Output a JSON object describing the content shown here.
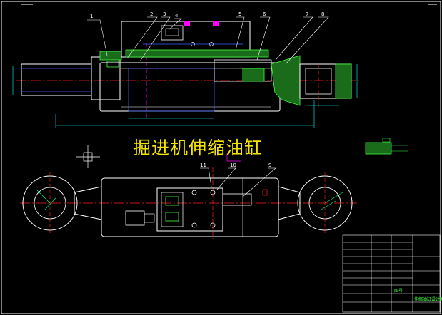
{
  "drawing": {
    "title": "掘进机伸缩油缸",
    "part_labels_top": [
      "1",
      "2",
      "3",
      "4",
      "5",
      "6",
      "7",
      "8"
    ],
    "part_labels_bottom": [
      "11",
      "10",
      "9"
    ],
    "title_block": {
      "label_a": "图号",
      "label_b": "伸缩油缸设计图"
    }
  },
  "colors": {
    "background": "#000000",
    "outline": "#ffffff",
    "hidden": "#4060ff",
    "center": "#ff2020",
    "hatch": "#40ff40",
    "dimension": "#00ffff",
    "title": "#f5e400",
    "accent": "#ff00ff"
  }
}
